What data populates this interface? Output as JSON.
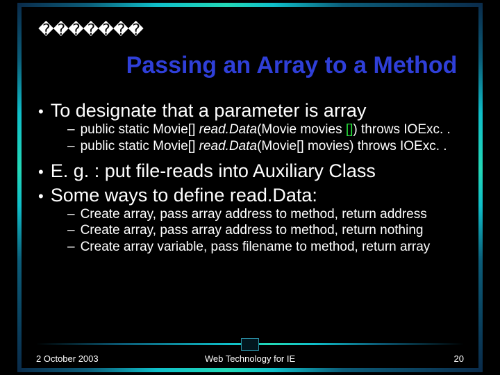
{
  "placeholder": "�������",
  "title": "Passing an Array to a Method",
  "b1": "To designate that a parameter is array",
  "b1a_pre": "public static Movie[] ",
  "b1a_it": "read.Data",
  "b1a_mid": "(Movie movies ",
  "b1a_green": "[]",
  "b1a_post": ") throws IOExc. .",
  "b1b_pre": "public static Movie[] ",
  "b1b_it": "read.Data",
  "b1b_post": "(Movie[] movies) throws IOExc. .",
  "b2": "E. g. : put file-reads into Auxiliary Class",
  "b3": "Some ways to define read.Data:",
  "b3a": "Create array, pass array address to method, return address",
  "b3b": "Create array, pass array address to method, return nothing",
  "b3c": "Create array variable, pass filename to method, return array",
  "footer_left": "2 October 2003",
  "footer_center": "Web Technology for IE",
  "footer_right": "20"
}
